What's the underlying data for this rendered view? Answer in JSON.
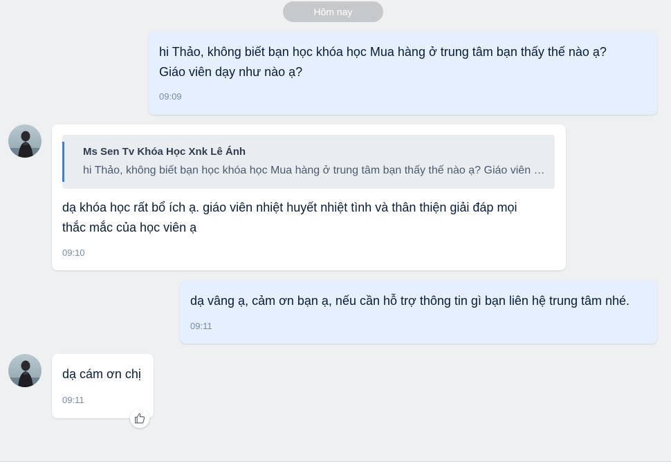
{
  "date_divider": "Hôm nay",
  "messages": [
    {
      "direction": "outgoing",
      "line1": "hi Thảo, không biết bạn học khóa học Mua hàng ở trung tâm bạn thấy thế nào ạ?",
      "line2": "Giáo viên dạy như nào ạ?",
      "time": "09:09"
    },
    {
      "direction": "incoming",
      "quote": {
        "sender": "Ms Sen Tv Khóa Học Xnk Lê Ánh",
        "text": "hi Thảo, không biết bạn học khóa học Mua hàng ở trung tâm bạn thấy thế nào ạ? Giáo viên dạy như nào ạ?"
      },
      "line1": "dạ khóa học rất bổ ích ạ. giáo viên nhiệt huyết nhiệt tình và thân thiện giải đáp mọi",
      "line2": "thắc mắc của học viên ạ",
      "time": "09:10"
    },
    {
      "direction": "outgoing",
      "line1": "dạ vâng ạ, cảm ơn bạn ạ, nếu cần hỗ trợ thông tin gì bạn liên hệ trung tâm nhé.",
      "time": "09:11"
    },
    {
      "direction": "incoming",
      "line1": "dạ cám ơn chị",
      "time": "09:11",
      "reaction_icon": "thumbs-up-icon"
    }
  ],
  "colors": {
    "background": "#eef0f1",
    "outgoing_bubble": "#e5efff",
    "incoming_bubble": "#ffffff",
    "quote_accent": "#3d7edb",
    "time_text": "#7589a3"
  }
}
